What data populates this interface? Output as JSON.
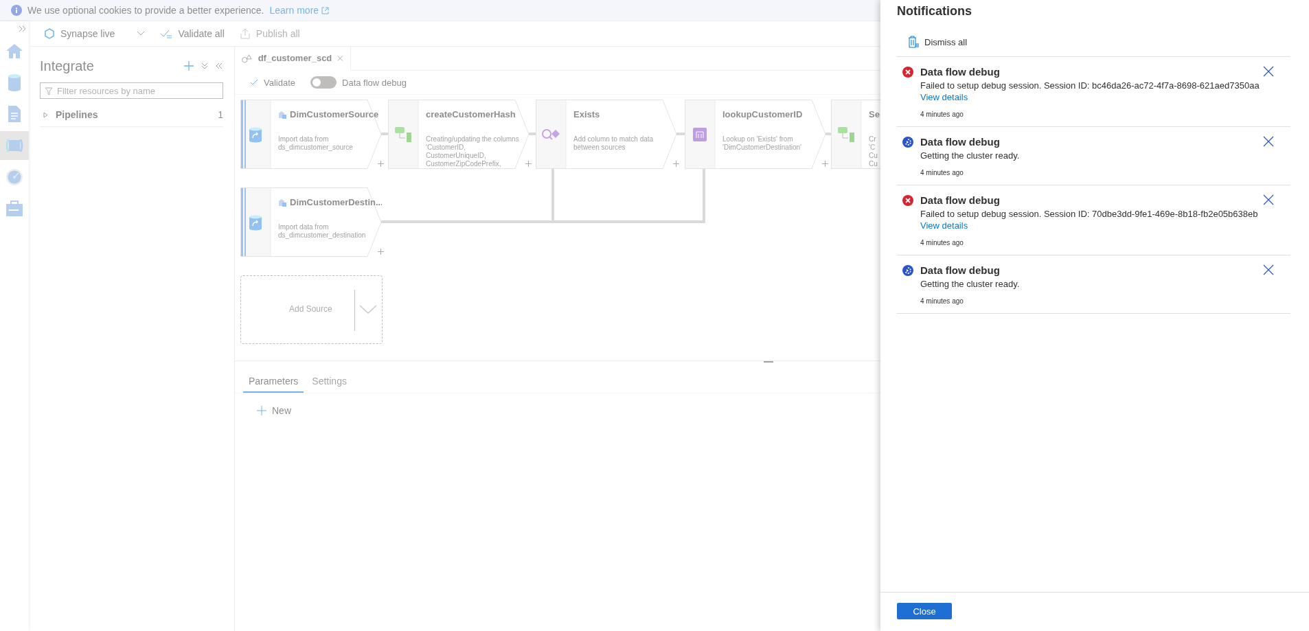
{
  "cookie_bar": {
    "message": "We use optional cookies to provide a better experience.",
    "link": "Learn more"
  },
  "nav_rail": [
    {
      "selected": false
    },
    {
      "selected": false
    },
    {
      "selected": false
    },
    {
      "selected": true
    },
    {
      "selected": false
    },
    {
      "selected": false
    }
  ],
  "toolbar": [
    {
      "label": "Synapse live",
      "kind": "dropdown",
      "disabled": false
    },
    {
      "label": "Validate all",
      "kind": "validate",
      "disabled": false
    },
    {
      "label": "Publish all",
      "kind": "publish",
      "disabled": true
    }
  ],
  "sidebar": {
    "title": "Integrate",
    "filter": {
      "placeholder": "Filter resources by name"
    },
    "tree": [
      {
        "label": "Pipelines",
        "count": "1",
        "expanded": false
      }
    ]
  },
  "editor": {
    "tab": {
      "label": "df_customer_scd",
      "selected": true
    },
    "actions": {
      "validate": "Validate",
      "debug_toggle": {
        "label": "Data flow debug",
        "on": false
      }
    },
    "nodes": [
      {
        "kind": "source",
        "title": "DimCustomerSource",
        "description": [
          "Import data from",
          "ds_dimcustomer_source"
        ]
      },
      {
        "kind": "derive",
        "title": "createCustomerHash",
        "description": [
          "Creating/updating the columns",
          "'CustomerID,",
          "CustomerUniqueID,",
          "CustomerZipCodePrefix,"
        ]
      },
      {
        "kind": "exists",
        "title": "Exists",
        "description": [
          "Add column to match data",
          "between sources"
        ]
      },
      {
        "kind": "lookup",
        "title": "lookupCustomerID",
        "description": [
          "Lookup on 'Exists' from",
          "'DimCustomerDestination'"
        ]
      },
      {
        "kind": "derive",
        "title": "Se",
        "description": [
          "Cr",
          "'C",
          "Cu",
          "Cu"
        ]
      },
      {
        "kind": "source",
        "title": "DimCustomerDestin...",
        "description": [
          "Import data from",
          "ds_dimcustomer_destination"
        ]
      }
    ],
    "add_source": "Add Source",
    "bottom_tabs": [
      {
        "label": "Parameters",
        "selected": true
      },
      {
        "label": "Settings",
        "selected": false
      }
    ],
    "new_button": "New"
  },
  "notifications": {
    "title": "Notifications",
    "dismiss_all": "Dismiss all",
    "items": [
      {
        "kind": "error",
        "title": "Data flow debug",
        "message": "Failed to setup debug session. Session ID: bc46da26-ac72-4f7a-8698-621aed7350aa",
        "link": "View details",
        "time": "4 minutes ago"
      },
      {
        "kind": "progress",
        "title": "Data flow debug",
        "message": "Getting the cluster ready.",
        "time": "4 minutes ago"
      },
      {
        "kind": "error",
        "title": "Data flow debug",
        "message": "Failed to setup debug session. Session ID: 70dbe3dd-9fe1-469e-8b18-fb2e05b638eb",
        "link": "View details",
        "time": "4 minutes ago"
      },
      {
        "kind": "progress",
        "title": "Data flow debug",
        "message": "Getting the cluster ready.",
        "time": "4 minutes ago"
      }
    ],
    "close_button": "Close"
  }
}
